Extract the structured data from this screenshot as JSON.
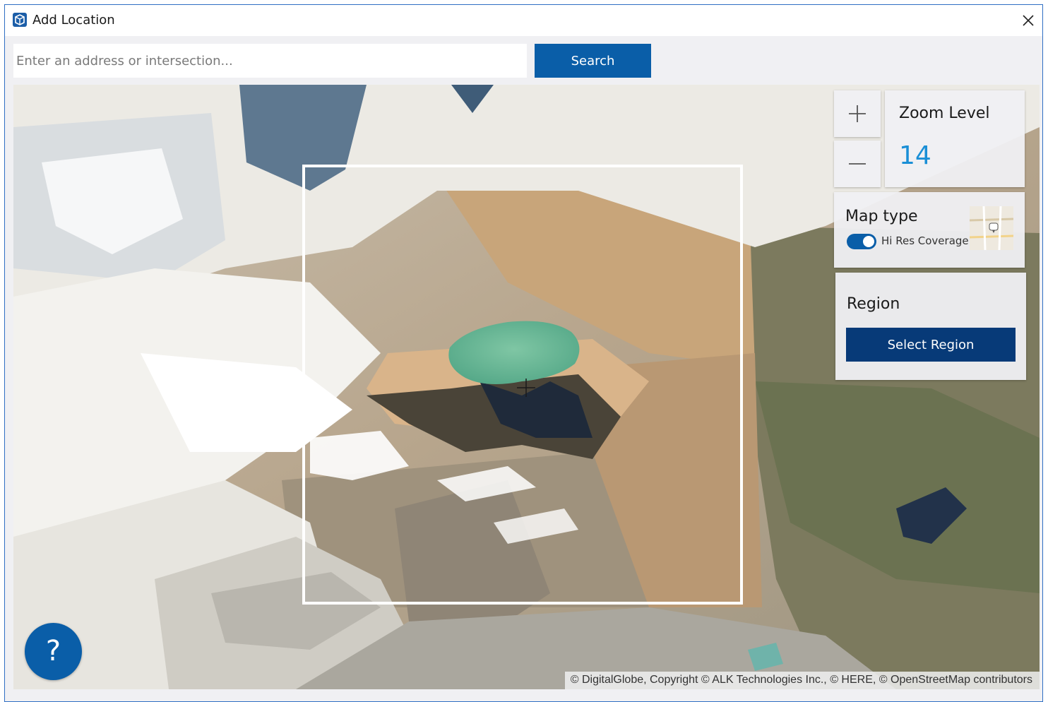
{
  "window": {
    "title": "Add Location",
    "app_icon": "app-logo-icon",
    "close_icon": "close-icon"
  },
  "search": {
    "placeholder": "Enter an address or intersection...",
    "value": "",
    "button_label": "Search"
  },
  "map": {
    "map_type": "satellite",
    "attribution": "© DigitalGlobe, Copyright © ALK Technologies Inc., © HERE, © OpenStreetMap contributors"
  },
  "zoom": {
    "label": "Zoom Level",
    "value": "14",
    "zoom_in_icon": "plus-icon",
    "zoom_out_icon": "minus-icon"
  },
  "map_type": {
    "label": "Map type",
    "toggle_label": "Hi Res Coverage",
    "toggle_on": true
  },
  "region": {
    "label": "Region",
    "button_label": "Select Region"
  },
  "help": {
    "label": "?"
  },
  "colors": {
    "primary_button": "#0a5ea8",
    "region_button": "#073a78",
    "zoom_value": "#1a8fd6",
    "window_bg": "#f0f0f3"
  }
}
